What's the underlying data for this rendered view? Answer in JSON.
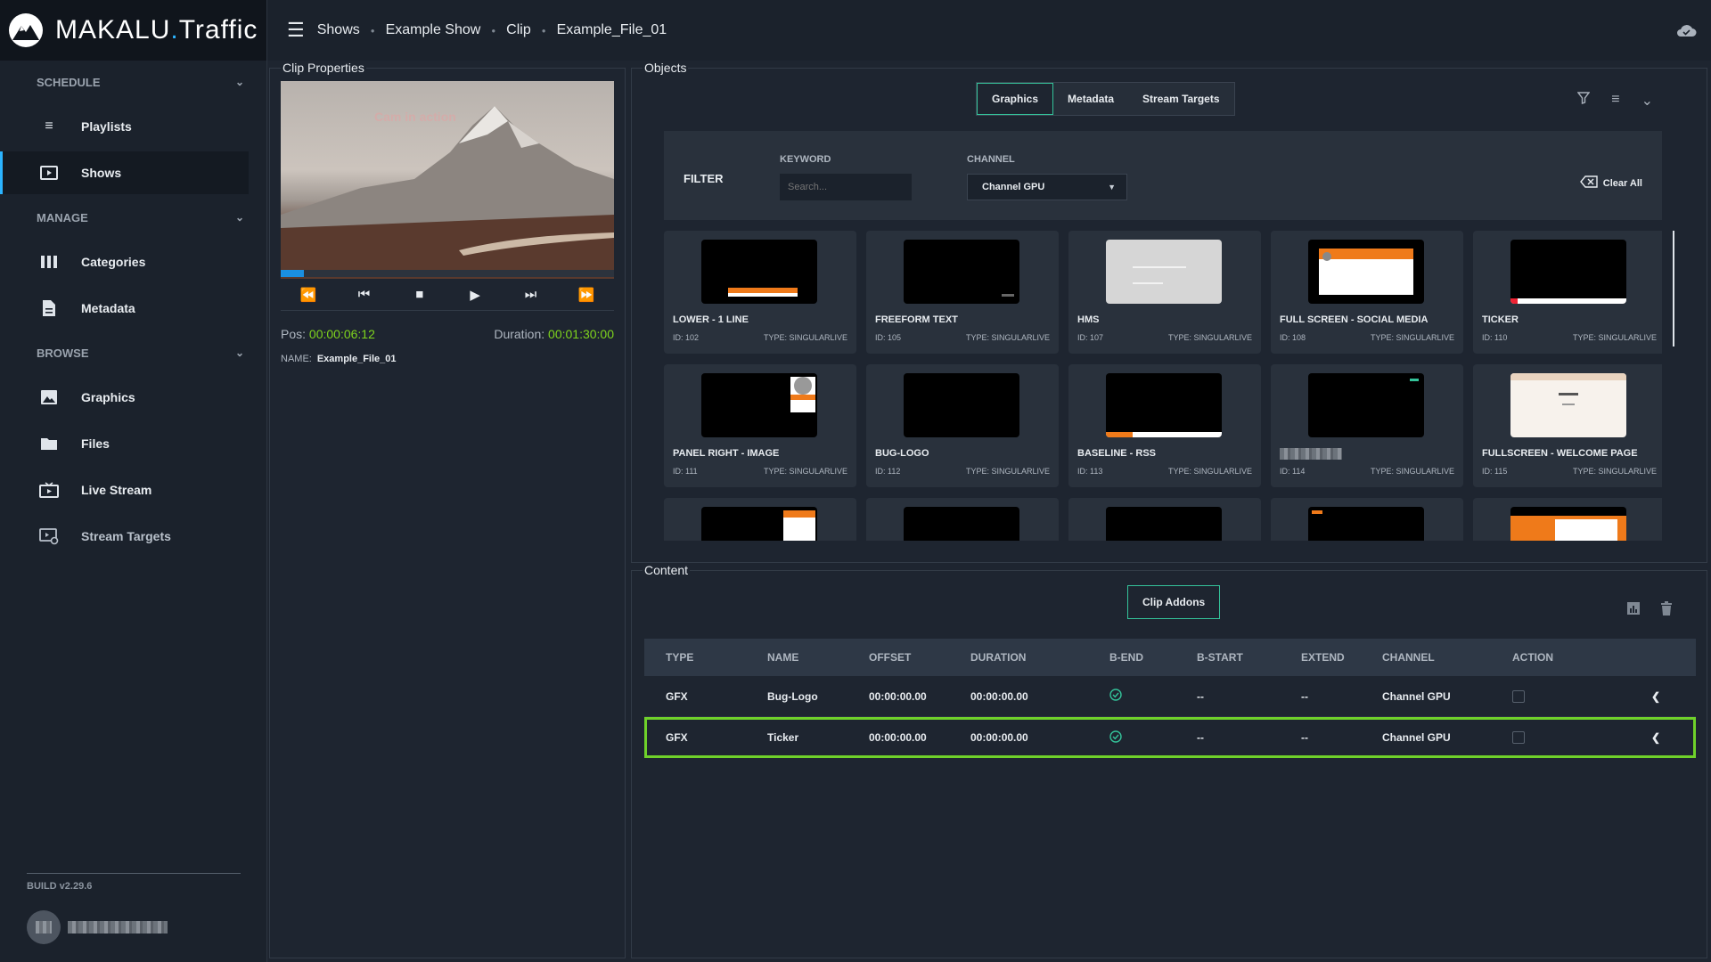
{
  "app": {
    "brand_main": "MAKALU",
    "brand_dot": ".",
    "brand_sub": "Traffic"
  },
  "breadcrumb": [
    "Shows",
    "Example Show",
    "Clip",
    "Example_File_01"
  ],
  "sidebar": {
    "sections": [
      {
        "label": "SCHEDULE",
        "items": [
          {
            "label": "Playlists",
            "icon": "playlist-icon"
          },
          {
            "label": "Shows",
            "icon": "play-box-icon",
            "active": true
          }
        ]
      },
      {
        "label": "MANAGE",
        "items": [
          {
            "label": "Categories",
            "icon": "columns-icon"
          },
          {
            "label": "Metadata",
            "icon": "document-icon"
          }
        ]
      },
      {
        "label": "BROWSE",
        "items": [
          {
            "label": "Graphics",
            "icon": "image-icon"
          },
          {
            "label": "Files",
            "icon": "folder-icon"
          },
          {
            "label": "Live Stream",
            "icon": "live-tv-icon"
          },
          {
            "label": "Stream Targets",
            "icon": "stream-target-icon"
          }
        ]
      }
    ],
    "build": "BUILD v2.29.6"
  },
  "clip_properties": {
    "title": "Clip Properties",
    "pos_label": "Pos:",
    "pos_value": "00:00:06:12",
    "duration_label": "Duration:",
    "duration_value": "00:01:30:00",
    "name_label": "NAME:",
    "name_value": "Example_File_01",
    "progress_fraction": 0.07
  },
  "objects": {
    "title": "Objects",
    "tabs": [
      "Graphics",
      "Metadata",
      "Stream Targets"
    ],
    "active_tab": "Graphics",
    "filter": {
      "label": "FILTER",
      "keyword_label": "KEYWORD",
      "keyword_placeholder": "Search...",
      "channel_label": "CHANNEL",
      "channel_value": "Channel GPU",
      "clear_label": "Clear All"
    },
    "cards": [
      {
        "name": "LOWER - 1 LINE",
        "id": "ID: 102",
        "type": "TYPE: SINGULARLIVE"
      },
      {
        "name": "FREEFORM TEXT",
        "id": "ID: 105",
        "type": "TYPE: SINGULARLIVE"
      },
      {
        "name": "HMS",
        "id": "ID: 107",
        "type": "TYPE: SINGULARLIVE"
      },
      {
        "name": "FULL SCREEN - SOCIAL MEDIA",
        "id": "ID: 108",
        "type": "TYPE: SINGULARLIVE"
      },
      {
        "name": "TICKER",
        "id": "ID: 110",
        "type": "TYPE: SINGULARLIVE"
      },
      {
        "name": "PANEL RIGHT - IMAGE",
        "id": "ID: 111",
        "type": "TYPE: SINGULARLIVE"
      },
      {
        "name": "BUG-LOGO",
        "id": "ID: 112",
        "type": "TYPE: SINGULARLIVE"
      },
      {
        "name": "BASELINE - RSS",
        "id": "ID: 113",
        "type": "TYPE: SINGULARLIVE"
      },
      {
        "name": "",
        "id": "ID: 114",
        "type": "TYPE: SINGULARLIVE"
      },
      {
        "name": "FULLSCREEN - WELCOME PAGE",
        "id": "ID: 115",
        "type": "TYPE: SINGULARLIVE"
      }
    ]
  },
  "content": {
    "title": "Content",
    "clip_addons_label": "Clip Addons",
    "columns": [
      "TYPE",
      "NAME",
      "OFFSET",
      "DURATION",
      "B-END",
      "B-START",
      "EXTEND",
      "CHANNEL",
      "ACTION"
    ],
    "rows": [
      {
        "type": "GFX",
        "name": "Bug-Logo",
        "offset": "00:00:00.00",
        "duration": "00:00:00.00",
        "b_start": "--",
        "extend": "--",
        "channel": "Channel GPU"
      },
      {
        "type": "GFX",
        "name": "Ticker",
        "offset": "00:00:00.00",
        "duration": "00:00:00.00",
        "b_start": "--",
        "extend": "--",
        "channel": "Channel GPU",
        "selected": true
      }
    ]
  },
  "colors": {
    "accent_blue": "#2bb4ff",
    "accent_green": "#34c39a",
    "time_green": "#7fd41d",
    "selection_green": "#6fd12a"
  }
}
